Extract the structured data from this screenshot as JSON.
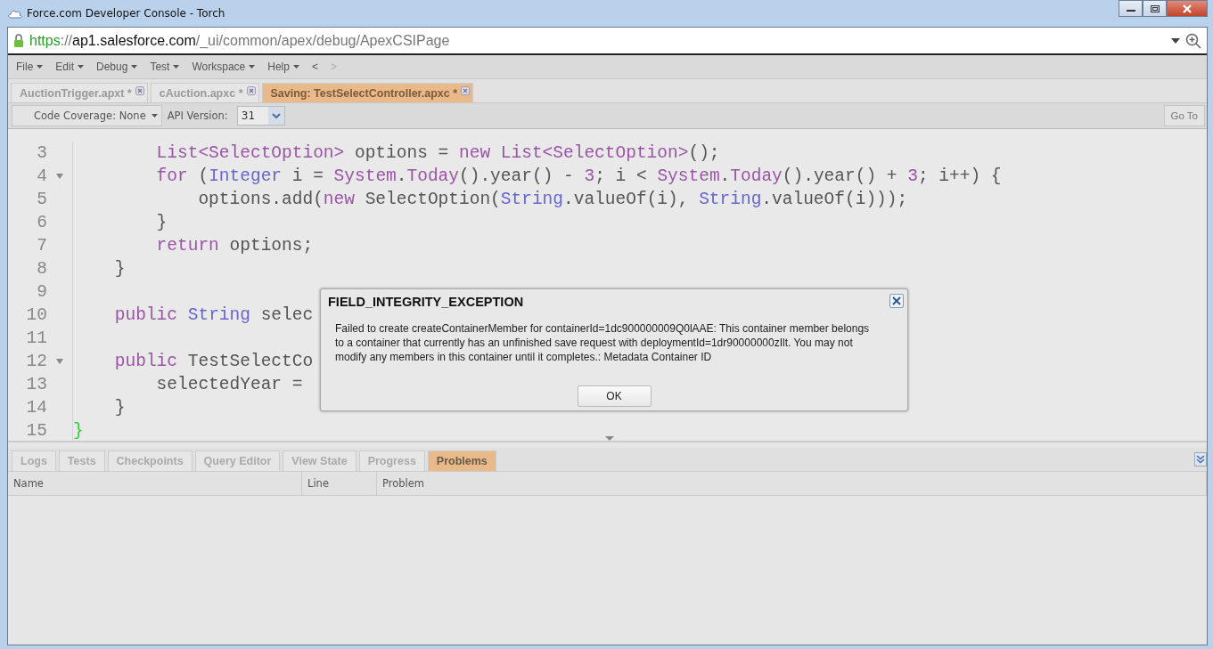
{
  "window": {
    "title": "Force.com Developer Console -  Torch"
  },
  "address_bar": {
    "scheme": "https",
    "separator": "://",
    "host": "ap1.salesforce.com",
    "path": "/_ui/common/apex/debug/ApexCSIPage"
  },
  "menu": [
    {
      "label": "File",
      "dropdown": true,
      "disabled": false
    },
    {
      "label": "Edit",
      "dropdown": true,
      "disabled": false
    },
    {
      "label": "Debug",
      "dropdown": true,
      "disabled": false
    },
    {
      "label": "Test",
      "dropdown": true,
      "disabled": false
    },
    {
      "label": "Workspace",
      "dropdown": true,
      "disabled": false
    },
    {
      "label": "Help",
      "dropdown": true,
      "disabled": false
    },
    {
      "label": "<",
      "dropdown": false,
      "disabled": false
    },
    {
      "label": ">",
      "dropdown": false,
      "disabled": true
    }
  ],
  "editor_tabs": [
    {
      "label": "AuctionTrigger.apxt *",
      "selected": false
    },
    {
      "label": "cAuction.apxc *",
      "selected": false
    },
    {
      "label": "Saving: TestSelectController.apxc *",
      "selected": true
    }
  ],
  "toolbar": {
    "code_coverage": "Code Coverage: None",
    "api_version_label": "API Version:",
    "api_version": "31",
    "goto": "Go To"
  },
  "code": [
    {
      "number": "3",
      "foldable": false,
      "tokens": [
        {
          "kind": "kw",
          "text": "        List<SelectOption>"
        },
        {
          "kind": "plain",
          "text": " options = "
        },
        {
          "kind": "kw",
          "text": "new List<SelectOption>"
        },
        {
          "kind": "plain",
          "text": "();"
        }
      ]
    },
    {
      "number": "4",
      "foldable": true,
      "tokens": [
        {
          "kind": "kw",
          "text": "        for"
        },
        {
          "kind": "plain",
          "text": " ("
        },
        {
          "kind": "type",
          "text": "Integer"
        },
        {
          "kind": "plain",
          "text": " i = "
        },
        {
          "kind": "kw",
          "text": "System"
        },
        {
          "kind": "plain",
          "text": "."
        },
        {
          "kind": "kw",
          "text": "Today"
        },
        {
          "kind": "plain",
          "text": "().year() - "
        },
        {
          "kind": "kw",
          "text": "3"
        },
        {
          "kind": "plain",
          "text": "; i < "
        },
        {
          "kind": "kw",
          "text": "System"
        },
        {
          "kind": "plain",
          "text": "."
        },
        {
          "kind": "kw",
          "text": "Today"
        },
        {
          "kind": "plain",
          "text": "().year() + "
        },
        {
          "kind": "kw",
          "text": "3"
        },
        {
          "kind": "plain",
          "text": "; i++) {"
        }
      ]
    },
    {
      "number": "5",
      "foldable": false,
      "tokens": [
        {
          "kind": "plain",
          "text": "            options.add("
        },
        {
          "kind": "kw",
          "text": "new"
        },
        {
          "kind": "plain",
          "text": " SelectOption("
        },
        {
          "kind": "type",
          "text": "String"
        },
        {
          "kind": "plain",
          "text": ".valueOf(i), "
        },
        {
          "kind": "type",
          "text": "String"
        },
        {
          "kind": "plain",
          "text": ".valueOf(i)));"
        }
      ]
    },
    {
      "number": "6",
      "foldable": false,
      "tokens": [
        {
          "kind": "plain",
          "text": "        }"
        }
      ]
    },
    {
      "number": "7",
      "foldable": false,
      "tokens": [
        {
          "kind": "kw",
          "text": "        return"
        },
        {
          "kind": "plain",
          "text": " options;"
        }
      ]
    },
    {
      "number": "8",
      "foldable": false,
      "tokens": [
        {
          "kind": "plain",
          "text": "    }"
        }
      ]
    },
    {
      "number": "9",
      "foldable": false
    },
    {
      "number": "10",
      "foldable": false,
      "tokens": [
        {
          "kind": "kw",
          "text": "    public"
        },
        {
          "kind": "type",
          "text": " String"
        },
        {
          "kind": "plain",
          "text": " selec"
        }
      ]
    },
    {
      "number": "11",
      "foldable": false
    },
    {
      "number": "12",
      "foldable": true,
      "tokens": [
        {
          "kind": "kw",
          "text": "    public"
        },
        {
          "kind": "plain",
          "text": " TestSelectCo"
        }
      ]
    },
    {
      "number": "13",
      "foldable": false,
      "tokens": [
        {
          "kind": "plain",
          "text": "        selectedYear ="
        }
      ]
    },
    {
      "number": "14",
      "foldable": false,
      "tokens": [
        {
          "kind": "plain",
          "text": "    }"
        }
      ]
    },
    {
      "number": "15",
      "foldable": false,
      "tokens": [
        {
          "kind": "brace",
          "text": "}"
        }
      ]
    }
  ],
  "dialog": {
    "title": "FIELD_INTEGRITY_EXCEPTION",
    "message": "Failed to create createContainerMember for containerId=1dc900000009Q0lAAE: This container member belongs to a container that currently has an unfinished save request with deploymentId=1dr90000000zIlt. You may not modify any members in this container until it completes.: Metadata Container ID",
    "button": "OK"
  },
  "bottom_tabs": [
    {
      "label": "Logs",
      "selected": false
    },
    {
      "label": "Tests",
      "selected": false
    },
    {
      "label": "Checkpoints",
      "selected": false
    },
    {
      "label": "Query Editor",
      "selected": false
    },
    {
      "label": "View State",
      "selected": false
    },
    {
      "label": "Progress",
      "selected": false
    },
    {
      "label": "Problems",
      "selected": true
    }
  ],
  "problems_table": {
    "columns": [
      "Name",
      "Line",
      "Problem"
    ]
  }
}
